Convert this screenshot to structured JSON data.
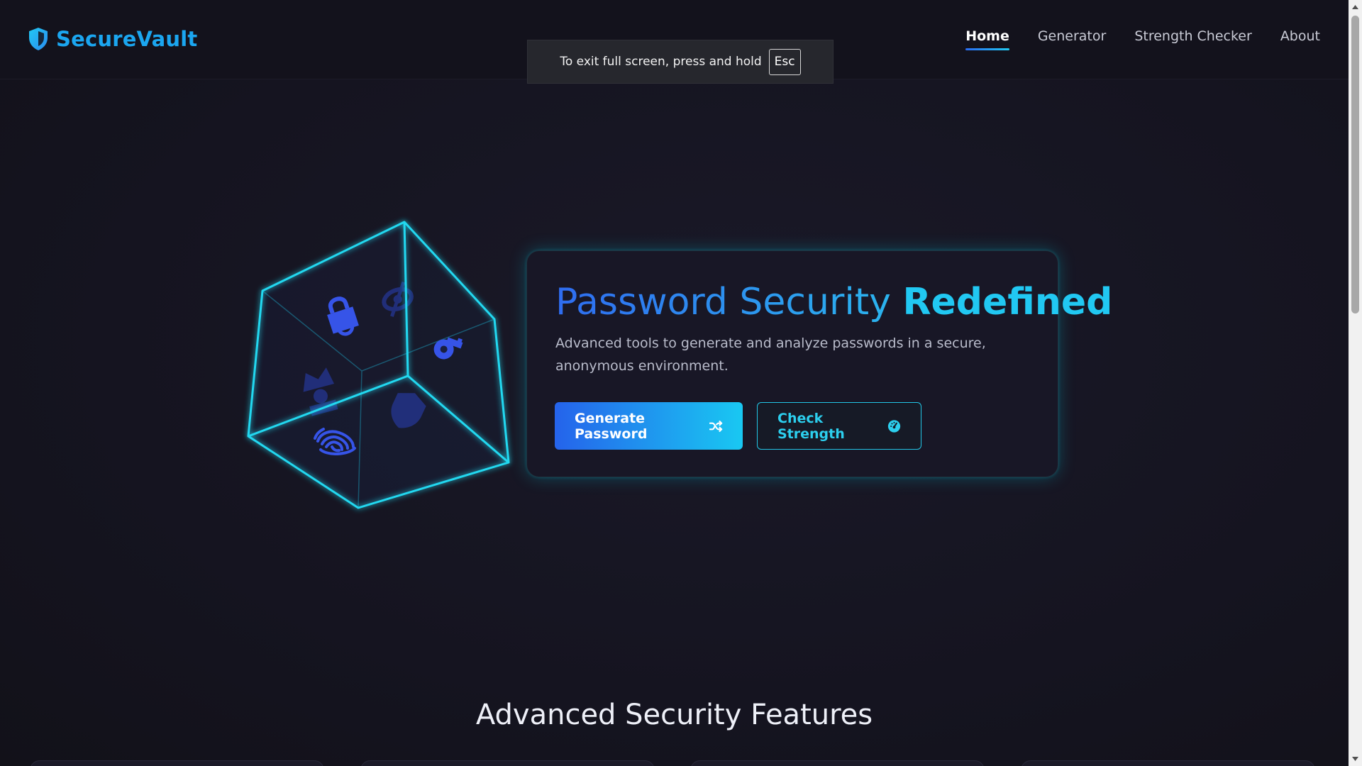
{
  "brand": {
    "name": "SecureVault",
    "icon": "shield-icon"
  },
  "nav": {
    "items": [
      {
        "label": "Home",
        "active": true
      },
      {
        "label": "Generator",
        "active": false
      },
      {
        "label": "Strength Checker",
        "active": false
      },
      {
        "label": "About",
        "active": false
      }
    ]
  },
  "fullscreen_toast": {
    "message": "To exit full screen, press and hold",
    "key": "Esc"
  },
  "hero": {
    "title_part1": "Password Security",
    "title_part2": "Redefined",
    "description": "Advanced tools to generate and analyze passwords in a secure, anonymous environment.",
    "primary_button": {
      "label": "Generate Password",
      "icon": "shuffle-icon"
    },
    "secondary_button": {
      "label": "Check Strength",
      "icon": "gauge-icon"
    }
  },
  "cube_icons": [
    "lock-icon",
    "eye-slash-icon",
    "key-icon",
    "user-secret-icon",
    "fingerprint-icon",
    "shield-icon"
  ],
  "features": {
    "title": "Advanced Security Features"
  },
  "colors": {
    "accent_blue": "#2563eb",
    "accent_cyan": "#21c8f2",
    "background": "#151420"
  }
}
